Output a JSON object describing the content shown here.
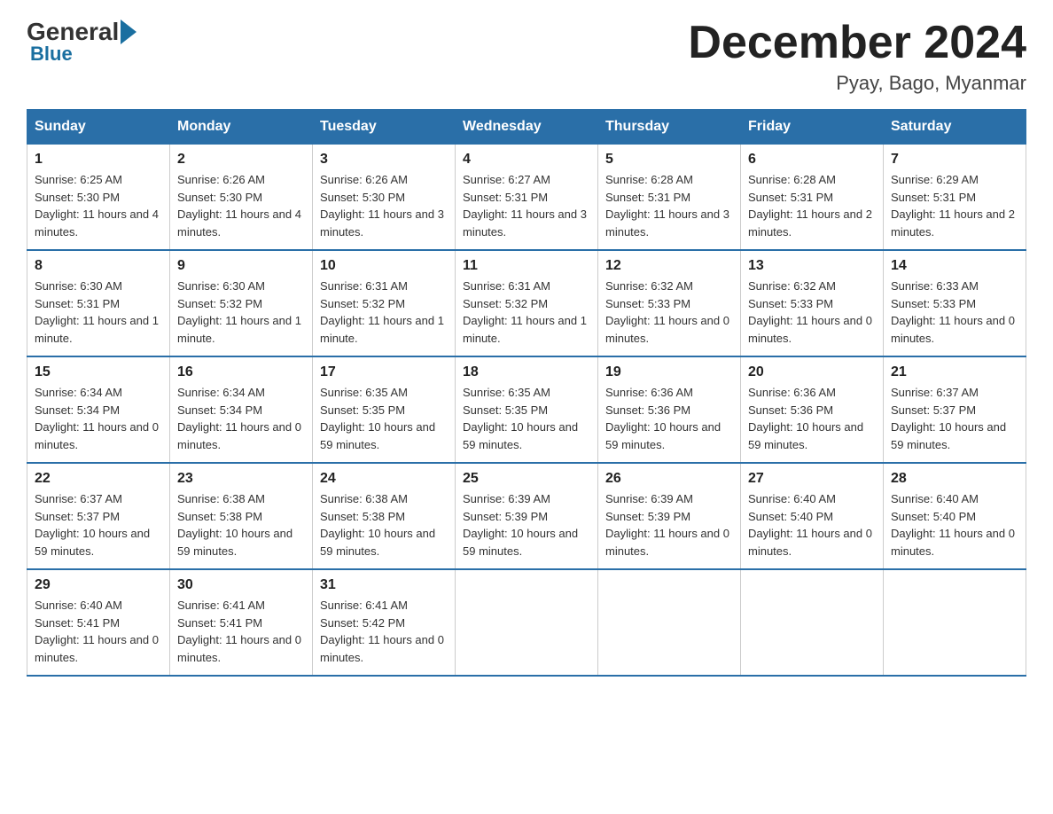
{
  "header": {
    "logo_general": "General",
    "logo_blue": "Blue",
    "month_title": "December 2024",
    "location": "Pyay, Bago, Myanmar"
  },
  "days_of_week": [
    "Sunday",
    "Monday",
    "Tuesday",
    "Wednesday",
    "Thursday",
    "Friday",
    "Saturday"
  ],
  "weeks": [
    [
      {
        "day": "1",
        "sunrise": "6:25 AM",
        "sunset": "5:30 PM",
        "daylight": "11 hours and 4 minutes."
      },
      {
        "day": "2",
        "sunrise": "6:26 AM",
        "sunset": "5:30 PM",
        "daylight": "11 hours and 4 minutes."
      },
      {
        "day": "3",
        "sunrise": "6:26 AM",
        "sunset": "5:30 PM",
        "daylight": "11 hours and 3 minutes."
      },
      {
        "day": "4",
        "sunrise": "6:27 AM",
        "sunset": "5:31 PM",
        "daylight": "11 hours and 3 minutes."
      },
      {
        "day": "5",
        "sunrise": "6:28 AM",
        "sunset": "5:31 PM",
        "daylight": "11 hours and 3 minutes."
      },
      {
        "day": "6",
        "sunrise": "6:28 AM",
        "sunset": "5:31 PM",
        "daylight": "11 hours and 2 minutes."
      },
      {
        "day": "7",
        "sunrise": "6:29 AM",
        "sunset": "5:31 PM",
        "daylight": "11 hours and 2 minutes."
      }
    ],
    [
      {
        "day": "8",
        "sunrise": "6:30 AM",
        "sunset": "5:31 PM",
        "daylight": "11 hours and 1 minute."
      },
      {
        "day": "9",
        "sunrise": "6:30 AM",
        "sunset": "5:32 PM",
        "daylight": "11 hours and 1 minute."
      },
      {
        "day": "10",
        "sunrise": "6:31 AM",
        "sunset": "5:32 PM",
        "daylight": "11 hours and 1 minute."
      },
      {
        "day": "11",
        "sunrise": "6:31 AM",
        "sunset": "5:32 PM",
        "daylight": "11 hours and 1 minute."
      },
      {
        "day": "12",
        "sunrise": "6:32 AM",
        "sunset": "5:33 PM",
        "daylight": "11 hours and 0 minutes."
      },
      {
        "day": "13",
        "sunrise": "6:32 AM",
        "sunset": "5:33 PM",
        "daylight": "11 hours and 0 minutes."
      },
      {
        "day": "14",
        "sunrise": "6:33 AM",
        "sunset": "5:33 PM",
        "daylight": "11 hours and 0 minutes."
      }
    ],
    [
      {
        "day": "15",
        "sunrise": "6:34 AM",
        "sunset": "5:34 PM",
        "daylight": "11 hours and 0 minutes."
      },
      {
        "day": "16",
        "sunrise": "6:34 AM",
        "sunset": "5:34 PM",
        "daylight": "11 hours and 0 minutes."
      },
      {
        "day": "17",
        "sunrise": "6:35 AM",
        "sunset": "5:35 PM",
        "daylight": "10 hours and 59 minutes."
      },
      {
        "day": "18",
        "sunrise": "6:35 AM",
        "sunset": "5:35 PM",
        "daylight": "10 hours and 59 minutes."
      },
      {
        "day": "19",
        "sunrise": "6:36 AM",
        "sunset": "5:36 PM",
        "daylight": "10 hours and 59 minutes."
      },
      {
        "day": "20",
        "sunrise": "6:36 AM",
        "sunset": "5:36 PM",
        "daylight": "10 hours and 59 minutes."
      },
      {
        "day": "21",
        "sunrise": "6:37 AM",
        "sunset": "5:37 PM",
        "daylight": "10 hours and 59 minutes."
      }
    ],
    [
      {
        "day": "22",
        "sunrise": "6:37 AM",
        "sunset": "5:37 PM",
        "daylight": "10 hours and 59 minutes."
      },
      {
        "day": "23",
        "sunrise": "6:38 AM",
        "sunset": "5:38 PM",
        "daylight": "10 hours and 59 minutes."
      },
      {
        "day": "24",
        "sunrise": "6:38 AM",
        "sunset": "5:38 PM",
        "daylight": "10 hours and 59 minutes."
      },
      {
        "day": "25",
        "sunrise": "6:39 AM",
        "sunset": "5:39 PM",
        "daylight": "10 hours and 59 minutes."
      },
      {
        "day": "26",
        "sunrise": "6:39 AM",
        "sunset": "5:39 PM",
        "daylight": "11 hours and 0 minutes."
      },
      {
        "day": "27",
        "sunrise": "6:40 AM",
        "sunset": "5:40 PM",
        "daylight": "11 hours and 0 minutes."
      },
      {
        "day": "28",
        "sunrise": "6:40 AM",
        "sunset": "5:40 PM",
        "daylight": "11 hours and 0 minutes."
      }
    ],
    [
      {
        "day": "29",
        "sunrise": "6:40 AM",
        "sunset": "5:41 PM",
        "daylight": "11 hours and 0 minutes."
      },
      {
        "day": "30",
        "sunrise": "6:41 AM",
        "sunset": "5:41 PM",
        "daylight": "11 hours and 0 minutes."
      },
      {
        "day": "31",
        "sunrise": "6:41 AM",
        "sunset": "5:42 PM",
        "daylight": "11 hours and 0 minutes."
      },
      null,
      null,
      null,
      null
    ]
  ],
  "labels": {
    "sunrise": "Sunrise:",
    "sunset": "Sunset:",
    "daylight": "Daylight:"
  }
}
